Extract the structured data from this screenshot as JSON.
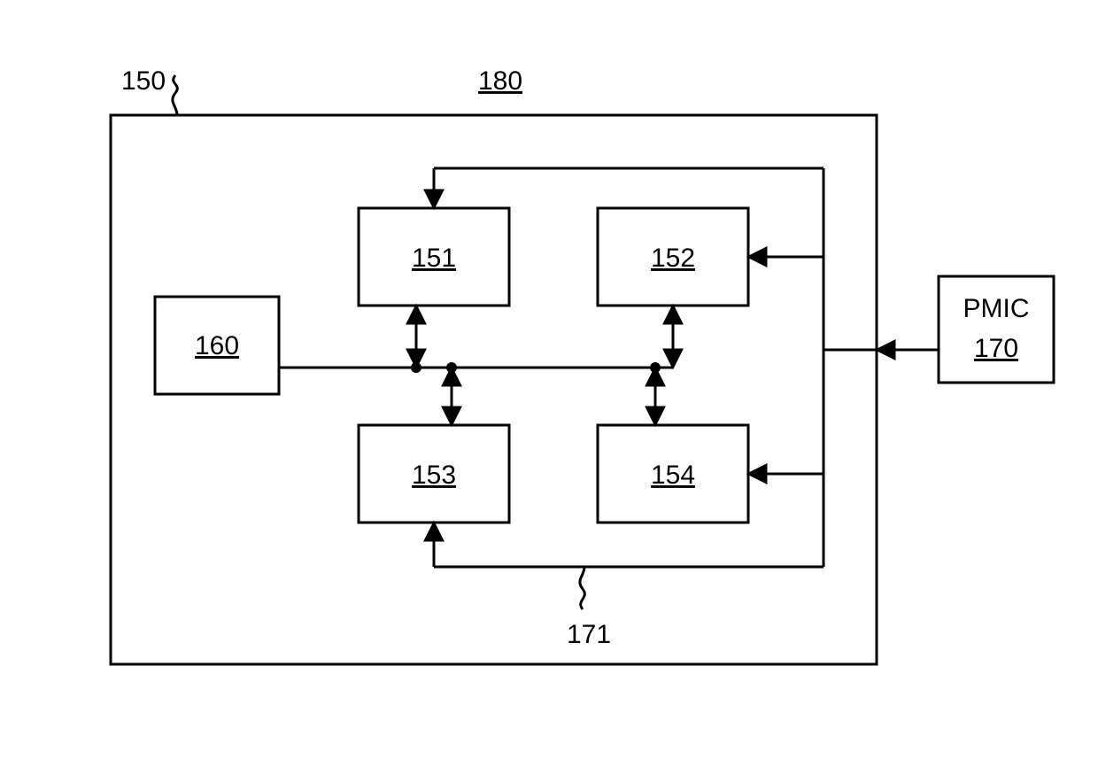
{
  "labels": {
    "outer_box": "180",
    "outer_label_top_left": "150",
    "block_160": "160",
    "block_151": "151",
    "block_152": "152",
    "block_153": "153",
    "block_154": "154",
    "bottom_wire": "171",
    "pmic_title": "PMIC",
    "pmic_id": "170"
  }
}
